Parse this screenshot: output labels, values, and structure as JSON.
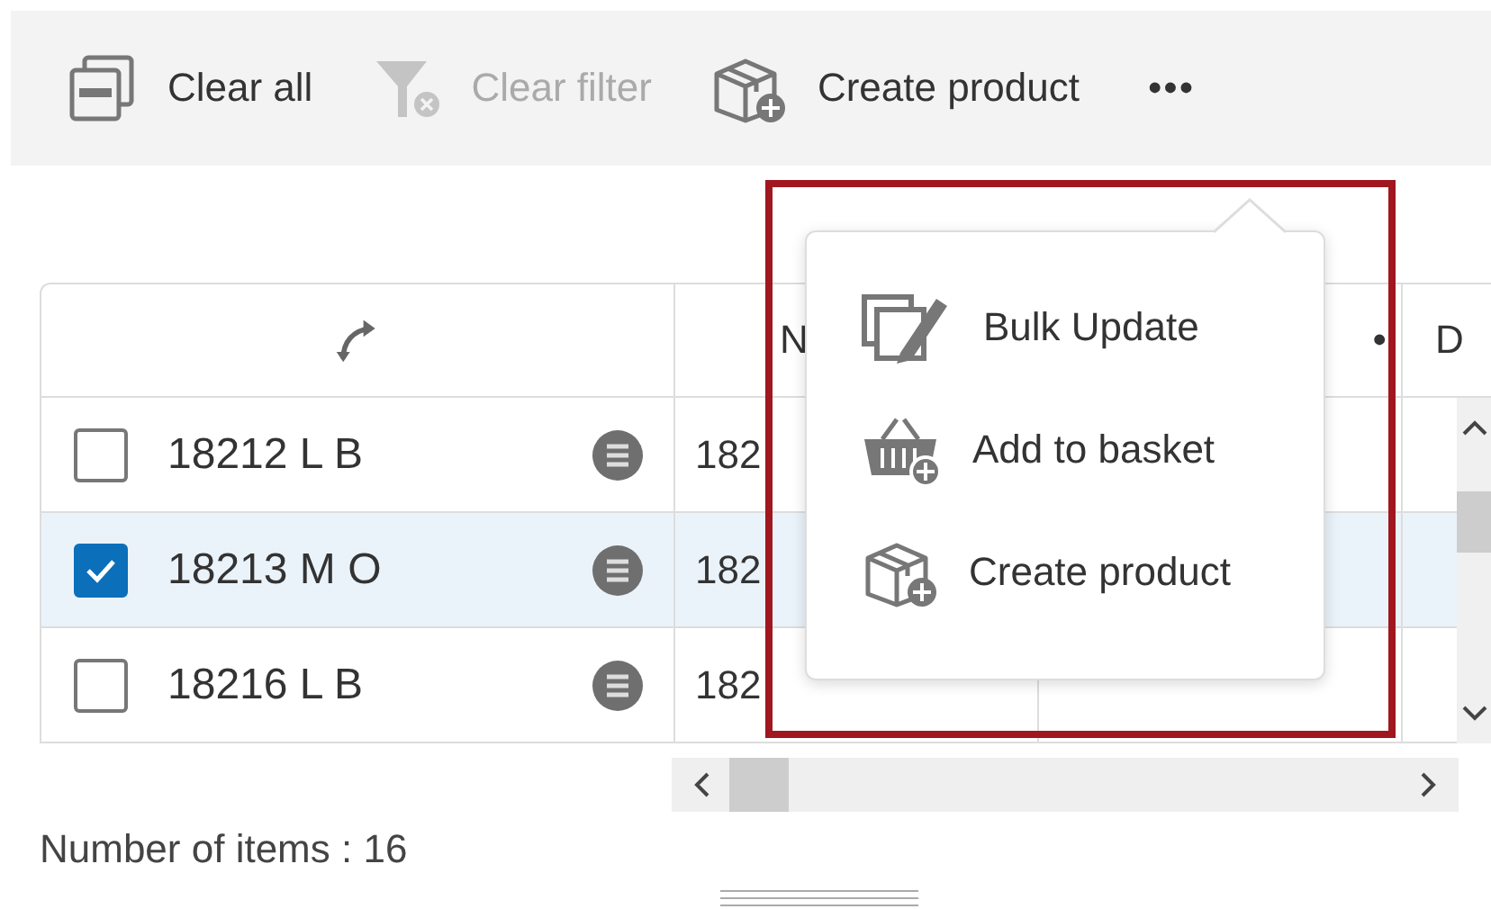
{
  "toolbar": {
    "items": [
      {
        "kind": "clear-all",
        "label": "Clear all",
        "disabled": false
      },
      {
        "kind": "clear-filter",
        "label": "Clear filter",
        "disabled": true
      },
      {
        "kind": "create-product",
        "label": "Create product",
        "disabled": false
      }
    ],
    "more": "•••"
  },
  "table": {
    "columns": [
      {
        "label": "N"
      },
      {
        "label": "•"
      },
      {
        "label": "D"
      }
    ],
    "rows": [
      {
        "name": "18212 L B",
        "checked": false,
        "selected": false,
        "column_2": "182"
      },
      {
        "name": "18213 M O",
        "checked": true,
        "selected": true,
        "column_2": "182"
      },
      {
        "name": "18216 L B",
        "checked": false,
        "selected": false,
        "column_2": "182"
      }
    ]
  },
  "popup": {
    "items": [
      {
        "kind": "bulk-update",
        "label": "Bulk Update"
      },
      {
        "kind": "add-to-basket",
        "label": "Add to basket"
      },
      {
        "kind": "create-product",
        "label": "Create product"
      }
    ]
  },
  "footer": {
    "count": "Number of items : 16"
  }
}
